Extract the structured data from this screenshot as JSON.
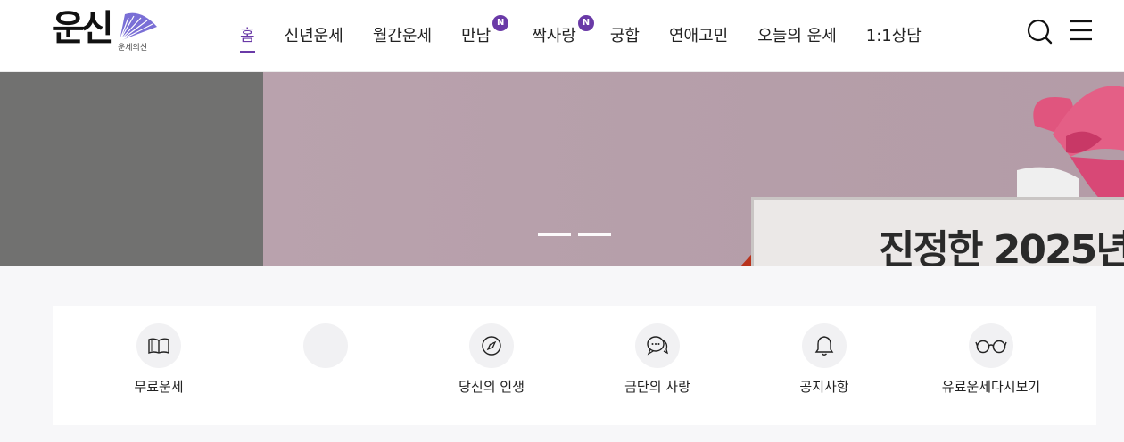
{
  "logo": {
    "main": "운신",
    "sub": "운세의신"
  },
  "nav": [
    {
      "label": "홈",
      "active": true,
      "badge": ""
    },
    {
      "label": "신년운세",
      "active": false,
      "badge": ""
    },
    {
      "label": "월간운세",
      "active": false,
      "badge": ""
    },
    {
      "label": "만남",
      "active": false,
      "badge": "N"
    },
    {
      "label": "짝사랑",
      "active": false,
      "badge": "N"
    },
    {
      "label": "궁합",
      "active": false,
      "badge": ""
    },
    {
      "label": "연애고민",
      "active": false,
      "badge": ""
    },
    {
      "label": "오늘의 운세",
      "active": false,
      "badge": ""
    },
    {
      "label": "1:1상담",
      "active": false,
      "badge": ""
    }
  ],
  "header_icons": {
    "search": "search-icon",
    "menu": "hamburger-menu-icon"
  },
  "banner": {
    "card_text": "진정한 2025년",
    "slide_count": 2
  },
  "quick_menu": [
    {
      "label": "무료운세",
      "icon": "book-icon"
    },
    {
      "label": "",
      "icon": ""
    },
    {
      "label": "당신의 인생",
      "icon": "compass-icon"
    },
    {
      "label": "금단의 사랑",
      "icon": "chat-bubbles-icon"
    },
    {
      "label": "공지사항",
      "icon": "bell-icon"
    },
    {
      "label": "유료운세다시보기",
      "icon": "glasses-icon"
    }
  ],
  "colors": {
    "accent": "#6a3aa7",
    "banner_side": "#717170",
    "banner_main": "#b59ea9"
  }
}
